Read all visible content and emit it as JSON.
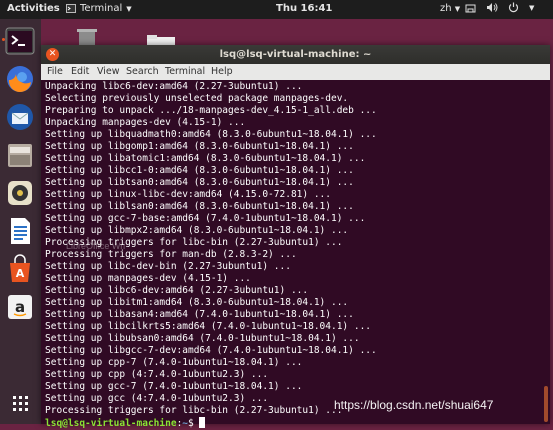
{
  "topbar": {
    "activities": "Activities",
    "app": "Terminal",
    "clock": "Thu 16:41",
    "lang": "zh",
    "tray_icons": [
      "network-icon",
      "volume-icon",
      "power-icon"
    ]
  },
  "dock": {
    "items": [
      "terminal",
      "firefox",
      "thunderbird",
      "files",
      "rhythmbox",
      "libreoffice-writer",
      "ubuntu-software",
      "amazon",
      "show-apps"
    ]
  },
  "window": {
    "title": "lsq@lsq-virtual-machine: ~",
    "menu": [
      "File",
      "Edit",
      "View",
      "Search",
      "Terminal",
      "Help"
    ]
  },
  "terminal": {
    "lines": [
      "Unpacking libc6-dev:amd64 (2.27-3ubuntu1) ...",
      "Selecting previously unselected package manpages-dev.",
      "Preparing to unpack .../18-manpages-dev_4.15-1_all.deb ...",
      "Unpacking manpages-dev (4.15-1) ...",
      "Setting up libquadmath0:amd64 (8.3.0-6ubuntu1~18.04.1) ...",
      "Setting up libgomp1:amd64 (8.3.0-6ubuntu1~18.04.1) ...",
      "Setting up libatomic1:amd64 (8.3.0-6ubuntu1~18.04.1) ...",
      "Setting up libcc1-0:amd64 (8.3.0-6ubuntu1~18.04.1) ...",
      "Setting up libtsan0:amd64 (8.3.0-6ubuntu1~18.04.1) ...",
      "Setting up linux-libc-dev:amd64 (4.15.0-72.81) ...",
      "Setting up liblsan0:amd64 (8.3.0-6ubuntu1~18.04.1) ...",
      "Setting up gcc-7-base:amd64 (7.4.0-1ubuntu1~18.04.1) ...",
      "Setting up libmpx2:amd64 (8.3.0-6ubuntu1~18.04.1) ...",
      "Processing triggers for libc-bin (2.27-3ubuntu1) ...",
      "Processing triggers for man-db (2.8.3-2) ...",
      "Setting up libc-dev-bin (2.27-3ubuntu1) ...",
      "Setting up manpages-dev (4.15-1) ...",
      "Setting up libc6-dev:amd64 (2.27-3ubuntu1) ...",
      "Setting up libitm1:amd64 (8.3.0-6ubuntu1~18.04.1) ...",
      "Setting up libasan4:amd64 (7.4.0-1ubuntu1~18.04.1) ...",
      "Setting up libcilkrts5:amd64 (7.4.0-1ubuntu1~18.04.1) ...",
      "Setting up libubsan0:amd64 (7.4.0-1ubuntu1~18.04.1) ...",
      "Setting up libgcc-7-dev:amd64 (7.4.0-1ubuntu1~18.04.1) ...",
      "Setting up cpp-7 (7.4.0-1ubuntu1~18.04.1) ...",
      "Setting up cpp (4:7.4.0-1ubuntu2.3) ...",
      "Setting up gcc-7 (7.4.0-1ubuntu1~18.04.1) ...",
      "Setting up gcc (4:7.4.0-1ubuntu2.3) ...",
      "Processing triggers for libc-bin (2.27-3ubuntu1) ..."
    ],
    "prompt_user": "lsq@lsq-virtual-machine",
    "prompt_sep": ":",
    "prompt_path": "~",
    "prompt_end": "$ "
  },
  "overlay": {
    "dock_tooltip": "LibreOffice Wri",
    "watermark": "https://blog.csdn.net/shuai647"
  },
  "colors": {
    "ubuntu_orange": "#e95420",
    "terminal_bg": "#300a24",
    "desktop_bg": "#6a2342",
    "prompt_green": "#8ae234",
    "prompt_blue": "#729fcf"
  }
}
